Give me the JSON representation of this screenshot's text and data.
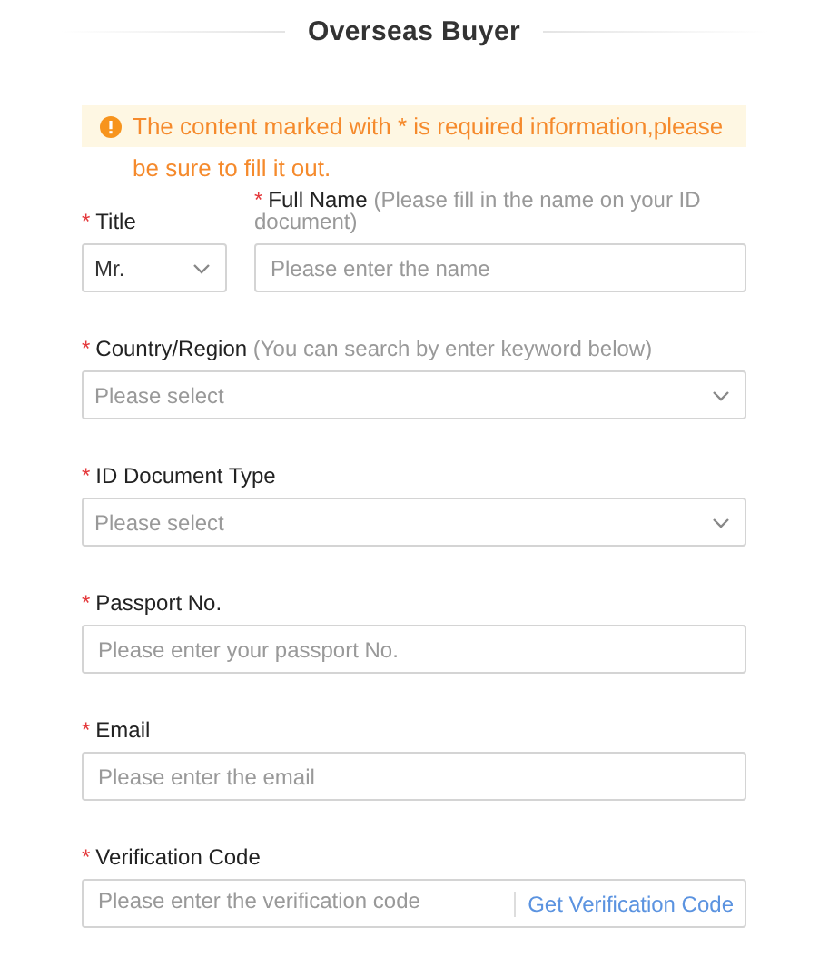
{
  "header": {
    "title": "Overseas Buyer"
  },
  "notice": {
    "text": "The content marked with * is required information,please be sure to fill it out."
  },
  "rows": [
    {
      "fields": [
        {
          "kind": "select",
          "required_mark": "*",
          "label": "Title",
          "value": "Mr."
        },
        {
          "kind": "input",
          "required_mark": "*",
          "label": "Full Name",
          "hint": "(Please fill in the name on your ID document)",
          "placeholder": "Please enter the name"
        }
      ]
    },
    {
      "fields": [
        {
          "kind": "select",
          "required_mark": "*",
          "label": "Country/Region",
          "hint": "(You can search by enter keyword below)",
          "placeholder": "Please select"
        }
      ]
    },
    {
      "fields": [
        {
          "kind": "select",
          "required_mark": "*",
          "label": "ID Document Type",
          "placeholder": "Please select"
        }
      ]
    },
    {
      "fields": [
        {
          "kind": "input",
          "required_mark": "*",
          "label": "Passport No.",
          "placeholder": "Please enter your passport No."
        }
      ]
    },
    {
      "fields": [
        {
          "kind": "input",
          "required_mark": "*",
          "label": "Email",
          "placeholder": "Please enter the email"
        }
      ]
    },
    {
      "fields": [
        {
          "kind": "code",
          "required_mark": "*",
          "label": "Verification Code",
          "placeholder": "Please enter the verification code",
          "button": "Get Verification Code"
        }
      ]
    }
  ]
}
